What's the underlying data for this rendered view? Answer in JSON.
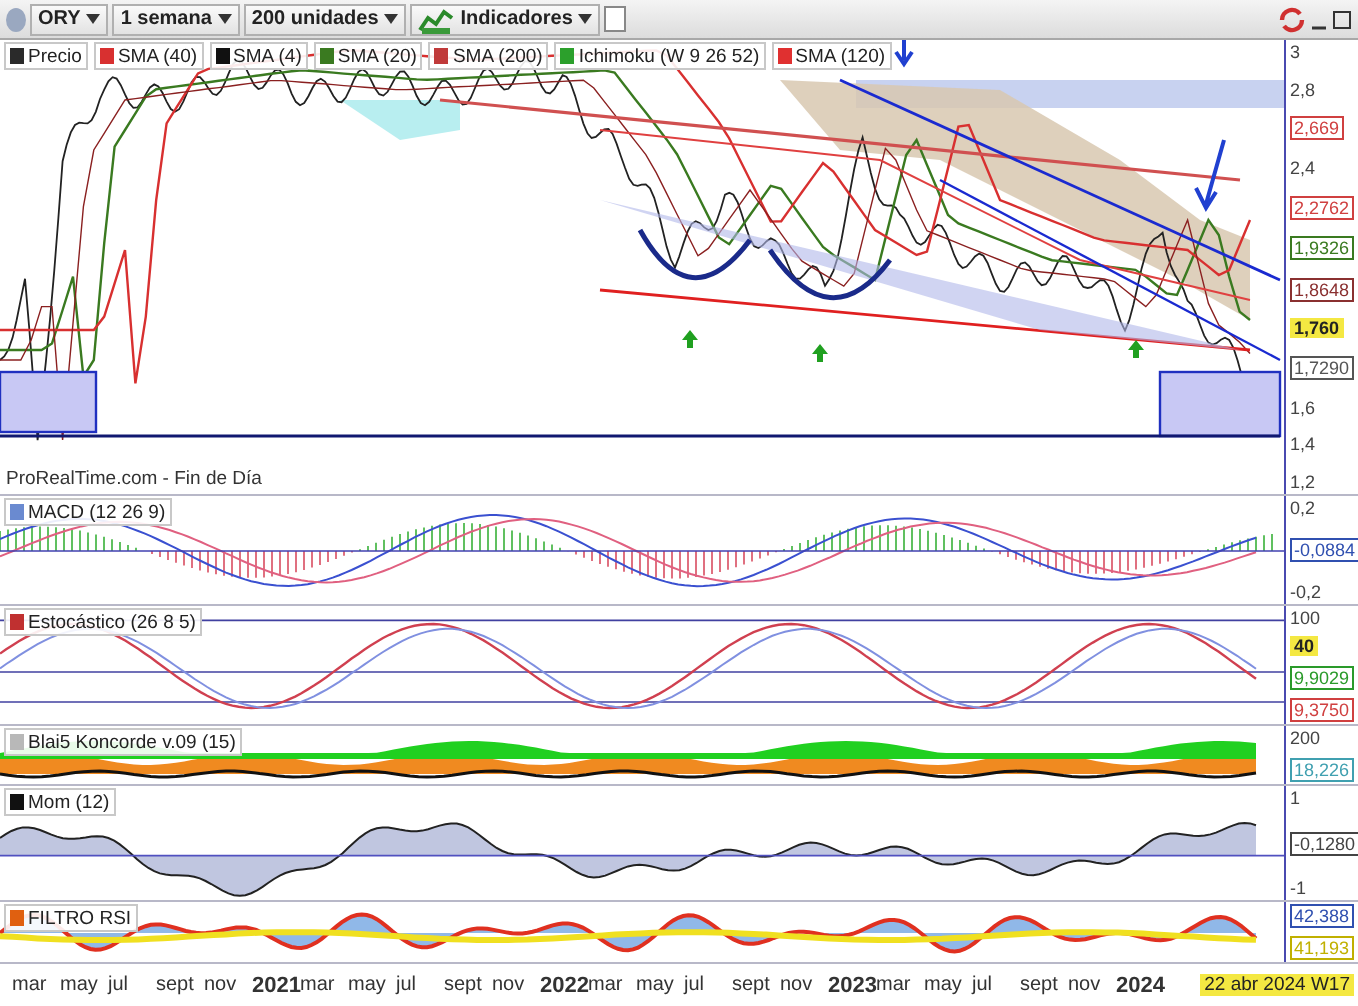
{
  "toolbar": {
    "symbol": "ORY",
    "period": "1 semana",
    "units": "200 unidades",
    "indicators": "Indicadores"
  },
  "panels": [
    {
      "kind": "price",
      "legend": [
        {
          "label": "Precio",
          "color": "#2a2a2a"
        },
        {
          "label": "SMA (40)",
          "color": "#d83030"
        },
        {
          "label": "SMA (4)",
          "color": "#111111"
        },
        {
          "label": "SMA (20)",
          "color": "#3a7a20"
        },
        {
          "label": "SMA (200)",
          "color": "#c03a3a"
        },
        {
          "label": "Ichimoku (W 9 26 52)",
          "color": "#2ca02c"
        },
        {
          "label": "SMA (120)",
          "color": "#e03030"
        }
      ],
      "axis": [
        {
          "text": "3",
          "kind": "tick"
        },
        {
          "text": "2,8",
          "kind": "tick"
        },
        {
          "text": "2,669",
          "kind": "tag",
          "color": "#d04040"
        },
        {
          "text": "2,4",
          "kind": "tick"
        },
        {
          "text": "2,2762",
          "kind": "tag",
          "color": "#d04040"
        },
        {
          "text": "1,9326",
          "kind": "tag",
          "color": "#3a7a20"
        },
        {
          "text": "1,8648",
          "kind": "tag",
          "color": "#8a3030"
        },
        {
          "text": "1,760",
          "kind": "highlight",
          "color": "#f4e842"
        },
        {
          "text": "1,7290",
          "kind": "tag",
          "color": "#555555"
        },
        {
          "text": "1,6",
          "kind": "tick"
        },
        {
          "text": "1,4",
          "kind": "tick"
        },
        {
          "text": "1,2",
          "kind": "tick"
        }
      ],
      "source": "ProRealTime.com - Fin de Día"
    },
    {
      "kind": "macd",
      "legend": [
        {
          "label": "MACD (12 26 9)",
          "color": "#6a8ad0"
        }
      ],
      "axis": [
        {
          "text": "0,2",
          "kind": "tick"
        },
        {
          "text": "-0,0884",
          "kind": "tag",
          "color": "#3050b0"
        },
        {
          "text": "-0,2",
          "kind": "tick"
        }
      ]
    },
    {
      "kind": "stochastic",
      "legend": [
        {
          "label": "Estocástico (26 8 5)",
          "color": "#c03030"
        }
      ],
      "axis": [
        {
          "text": "100",
          "kind": "tick"
        },
        {
          "text": "40",
          "kind": "highlight",
          "color": "#f4e842"
        },
        {
          "text": "9,9029",
          "kind": "tag",
          "color": "#2a9a2a"
        },
        {
          "text": "9,3750",
          "kind": "tag",
          "color": "#d04040"
        }
      ]
    },
    {
      "kind": "koncorde",
      "legend": [
        {
          "label": "Blai5 Koncorde v.09 (15)",
          "color": "#b8b8b8"
        }
      ],
      "axis": [
        {
          "text": "200",
          "kind": "tick"
        },
        {
          "text": "18,226",
          "kind": "tag",
          "color": "#40a0b0"
        }
      ]
    },
    {
      "kind": "momentum",
      "legend": [
        {
          "label": "Mom (12)",
          "color": "#111111"
        }
      ],
      "axis": [
        {
          "text": "1",
          "kind": "tick"
        },
        {
          "text": "-0,1280",
          "kind": "tag",
          "color": "#444444"
        },
        {
          "text": "-1",
          "kind": "tick"
        }
      ]
    },
    {
      "kind": "rsi",
      "legend": [
        {
          "label": "FILTRO RSI",
          "color": "#e06010"
        }
      ],
      "axis": [
        {
          "text": "42,388",
          "kind": "tag",
          "color": "#3050b0"
        },
        {
          "text": "41,193",
          "kind": "tag",
          "color": "#c0b000"
        }
      ]
    }
  ],
  "x_axis": {
    "labels": [
      {
        "text": "mar",
        "kind": "month"
      },
      {
        "text": "may",
        "kind": "month"
      },
      {
        "text": "jul",
        "kind": "month"
      },
      {
        "text": "sept",
        "kind": "month"
      },
      {
        "text": "nov",
        "kind": "month"
      },
      {
        "text": "2021",
        "kind": "year"
      },
      {
        "text": "mar",
        "kind": "month"
      },
      {
        "text": "may",
        "kind": "month"
      },
      {
        "text": "jul",
        "kind": "month"
      },
      {
        "text": "sept",
        "kind": "month"
      },
      {
        "text": "nov",
        "kind": "month"
      },
      {
        "text": "2022",
        "kind": "year"
      },
      {
        "text": "mar",
        "kind": "month"
      },
      {
        "text": "may",
        "kind": "month"
      },
      {
        "text": "jul",
        "kind": "month"
      },
      {
        "text": "sept",
        "kind": "month"
      },
      {
        "text": "nov",
        "kind": "month"
      },
      {
        "text": "2023",
        "kind": "year"
      },
      {
        "text": "mar",
        "kind": "month"
      },
      {
        "text": "may",
        "kind": "month"
      },
      {
        "text": "jul",
        "kind": "month"
      },
      {
        "text": "sept",
        "kind": "month"
      },
      {
        "text": "nov",
        "kind": "month"
      },
      {
        "text": "2024",
        "kind": "year"
      }
    ],
    "current_date": "22 abr 2024 W17"
  }
}
